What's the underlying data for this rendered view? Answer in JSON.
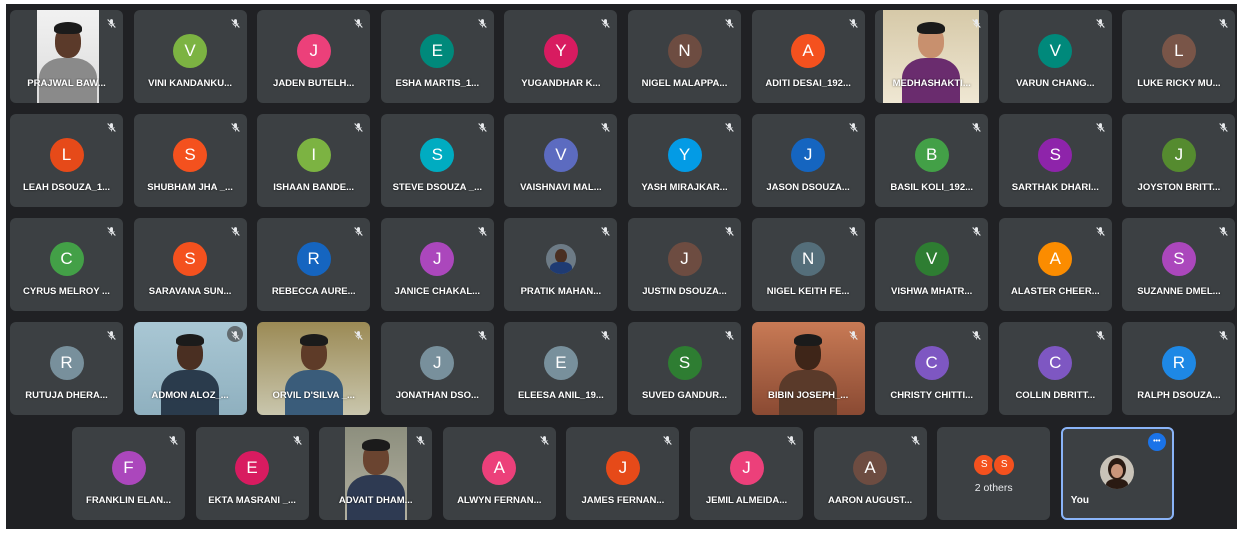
{
  "tiles_row1": [
    {
      "name": "PRAJWAL BAW...",
      "video": true
    },
    {
      "name": "VINI KANDANKU...",
      "initial": "V",
      "color": "#7cb342"
    },
    {
      "name": "JADEN BUTELH...",
      "initial": "J",
      "color": "#ec407a"
    },
    {
      "name": "ESHA MARTIS_1...",
      "initial": "E",
      "color": "#00897b"
    },
    {
      "name": "YUGANDHAR K...",
      "initial": "Y",
      "color": "#d81b60"
    },
    {
      "name": "NIGEL MALAPPA...",
      "initial": "N",
      "color": "#6d4c41"
    },
    {
      "name": "ADITI DESAI_192...",
      "initial": "A",
      "color": "#f4511e"
    },
    {
      "name": "MEDHASHAKTI...",
      "video": true
    },
    {
      "name": "VARUN CHANG...",
      "initial": "V",
      "color": "#00897b"
    },
    {
      "name": "LUKE RICKY MU...",
      "initial": "L",
      "color": "#795548"
    }
  ],
  "tiles_row2": [
    {
      "name": "LEAH DSOUZA_1...",
      "initial": "L",
      "color": "#e64a19"
    },
    {
      "name": "SHUBHAM JHA _...",
      "initial": "S",
      "color": "#f4511e"
    },
    {
      "name": "ISHAAN BANDE...",
      "initial": "I",
      "color": "#7cb342"
    },
    {
      "name": "STEVE DSOUZA _...",
      "initial": "S",
      "color": "#00acc1"
    },
    {
      "name": "VAISHNAVI MAL...",
      "initial": "V",
      "color": "#5c6bc0"
    },
    {
      "name": "YASH MIRAJKAR...",
      "initial": "Y",
      "color": "#039be5"
    },
    {
      "name": "JASON DSOUZA...",
      "initial": "J",
      "color": "#1565c0"
    },
    {
      "name": "BASIL KOLI_192...",
      "initial": "B",
      "color": "#43a047"
    },
    {
      "name": "SARTHAK DHARI...",
      "initial": "S",
      "color": "#8e24aa"
    },
    {
      "name": "JOYSTON BRITT...",
      "initial": "J",
      "color": "#558b2f"
    }
  ],
  "tiles_row3": [
    {
      "name": "CYRUS MELROY ...",
      "initial": "C",
      "color": "#43a047"
    },
    {
      "name": "SARAVANA SUN...",
      "initial": "S",
      "color": "#f4511e"
    },
    {
      "name": "REBECCA AURE...",
      "initial": "R",
      "color": "#1565c0"
    },
    {
      "name": "JANICE CHAKAL...",
      "initial": "J",
      "color": "#ab47bc"
    },
    {
      "name": "PRATIK MAHAN...",
      "photo": true
    },
    {
      "name": "JUSTIN DSOUZA...",
      "initial": "J",
      "color": "#6d4c41"
    },
    {
      "name": "NIGEL KEITH FE...",
      "initial": "N",
      "color": "#546e7a"
    },
    {
      "name": "VISHWA MHATR...",
      "initial": "V",
      "color": "#2e7d32"
    },
    {
      "name": "ALASTER CHEER...",
      "initial": "A",
      "color": "#fb8c00"
    },
    {
      "name": "SUZANNE DMEL...",
      "initial": "S",
      "color": "#ab47bc"
    }
  ],
  "tiles_row4": [
    {
      "name": "RUTUJA DHERA...",
      "initial": "R",
      "color": "#78909c"
    },
    {
      "name": "ADMON ALOZ_...",
      "video": true
    },
    {
      "name": "ORVIL D'SILVA _...",
      "video": true
    },
    {
      "name": "JONATHAN DSO...",
      "initial": "J",
      "color": "#78909c"
    },
    {
      "name": "ELEESA ANIL_19...",
      "initial": "E",
      "color": "#78909c"
    },
    {
      "name": "SUVED GANDUR...",
      "initial": "S",
      "color": "#2e7d32"
    },
    {
      "name": "BIBIN JOSEPH_...",
      "video": true
    },
    {
      "name": "CHRISTY CHITTI...",
      "initial": "C",
      "color": "#7e57c2"
    },
    {
      "name": "COLLIN DBRITT...",
      "initial": "C",
      "color": "#7e57c2"
    },
    {
      "name": "RALPH DSOUZA...",
      "initial": "R",
      "color": "#1e88e5"
    }
  ],
  "tiles_row5": [
    {
      "name": "FRANKLIN ELAN...",
      "initial": "F",
      "color": "#ab47bc"
    },
    {
      "name": "EKTA MASRANI _...",
      "initial": "E",
      "color": "#d81b60"
    },
    {
      "name": "ADVAIT DHAM...",
      "video": true
    },
    {
      "name": "ALWYN FERNAN...",
      "initial": "A",
      "color": "#ec407a"
    },
    {
      "name": "JAMES FERNAN...",
      "initial": "J",
      "color": "#e64a19"
    },
    {
      "name": "JEMIL ALMEIDA...",
      "initial": "J",
      "color": "#ec407a"
    },
    {
      "name": "AARON AUGUST...",
      "initial": "A",
      "color": "#6d4c41"
    }
  ],
  "others": {
    "label": "2 others",
    "initials": [
      "S",
      "S"
    ],
    "color": "#f4511e"
  },
  "self": {
    "label": "You",
    "more_icon": "more-options-icon"
  },
  "icons": {
    "mic": "mic-muted-icon"
  }
}
